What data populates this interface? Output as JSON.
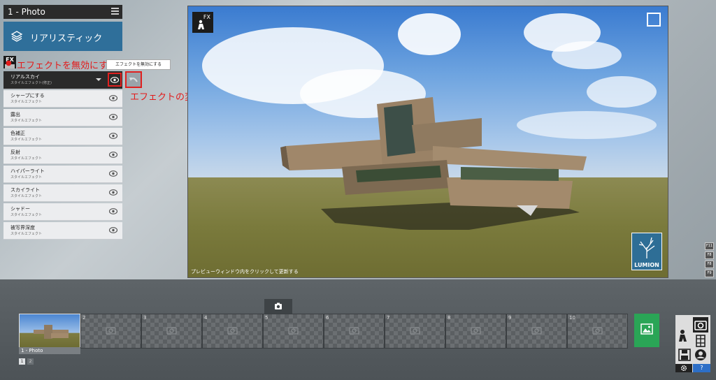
{
  "panel": {
    "title": "1 - Photo",
    "preset_label": "リアリスティック",
    "fx_label": "FX",
    "tooltip": "エフェクトを無効にする",
    "effects": [
      {
        "name": "リアルスカイ",
        "sub": "スタイルエフェクト(修正)"
      },
      {
        "name": "シャープにする",
        "sub": "スタイルエフェクト"
      },
      {
        "name": "露出",
        "sub": "スタイルエフェクト"
      },
      {
        "name": "色補正",
        "sub": "スタイルエフェクト"
      },
      {
        "name": "反射",
        "sub": "スタイルエフェクト"
      },
      {
        "name": "ハイパーライト",
        "sub": "スタイルエフェクト"
      },
      {
        "name": "スカイライト",
        "sub": "スタイルエフェクト"
      },
      {
        "name": "シャドー",
        "sub": "スタイルエフェクト"
      },
      {
        "name": "被写界深度",
        "sub": "スタイルエフェクト"
      }
    ]
  },
  "annotations": {
    "disable_effect": "エフェクトを無効にする",
    "revert_effect": "エフェクトの変更内容をもとに戻す"
  },
  "viewport": {
    "fx_label": "FX",
    "hint": "プレビューウィンドウ内をクリックして更新する",
    "logo": "LUMION"
  },
  "side_buttons": [
    "F11",
    "F8",
    "F8",
    "F9"
  ],
  "photo_strip": {
    "active_label": "1 - Photo",
    "slots": [
      "2",
      "3",
      "4",
      "5",
      "6",
      "7",
      "8",
      "9",
      "10"
    ],
    "pages": [
      "1",
      "2"
    ]
  },
  "colors": {
    "preset": "#2f6f9a",
    "annotation": "#e31a1a",
    "render_button": "#2aa556"
  }
}
